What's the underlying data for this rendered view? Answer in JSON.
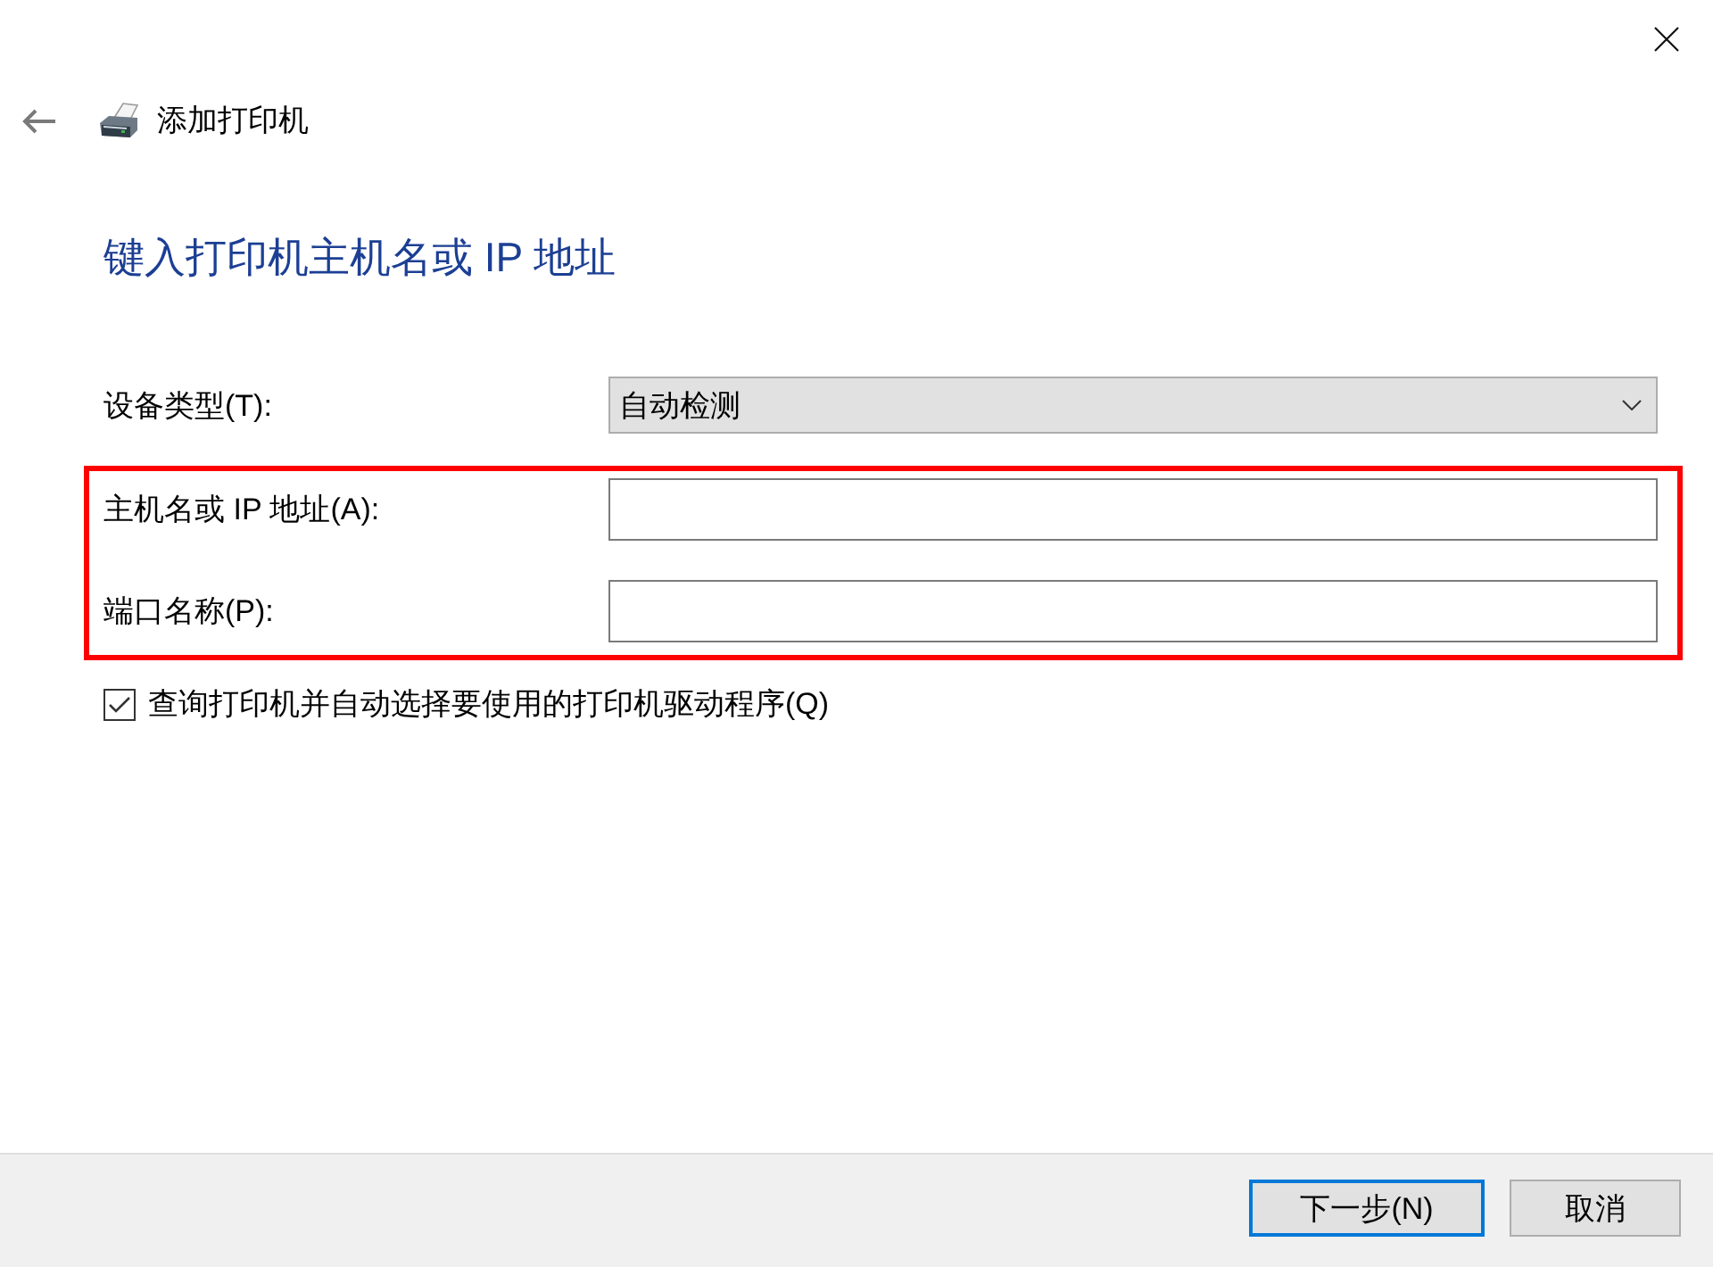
{
  "header": {
    "title": "添加打印机"
  },
  "heading": "键入打印机主机名或 IP 地址",
  "form": {
    "fields": [
      {
        "kind": "dropdown",
        "label": "设备类型(T):",
        "value": "自动检测",
        "highlighted": false
      },
      {
        "kind": "text",
        "label": "主机名或 IP 地址(A):",
        "highlighted": true
      },
      {
        "kind": "text",
        "label": "端口名称(P):",
        "highlighted": true
      }
    ]
  },
  "checkbox": {
    "label": "查询打印机并自动选择要使用的打印机驱动程序(Q)",
    "checked": true
  },
  "buttons": [
    {
      "label": "下一步(N)",
      "default": true
    },
    {
      "label": "取消",
      "default": false
    }
  ]
}
